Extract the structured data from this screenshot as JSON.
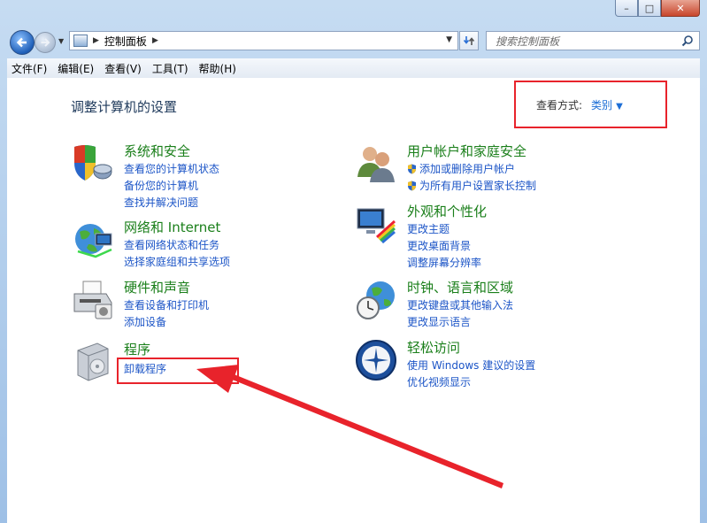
{
  "window": {
    "controls": {
      "minimize": "–",
      "maximize": "□",
      "close": "✕"
    }
  },
  "address": {
    "breadcrumb": "控制面板"
  },
  "search": {
    "placeholder": "搜索控制面板"
  },
  "menu": [
    "文件(F)",
    "编辑(E)",
    "查看(V)",
    "工具(T)",
    "帮助(H)"
  ],
  "heading": "调整计算机的设置",
  "view_mode": {
    "label": "查看方式:",
    "value": "类别"
  },
  "categories": {
    "system": {
      "title": "系统和安全",
      "links": [
        "查看您的计算机状态",
        "备份您的计算机",
        "查找并解决问题"
      ],
      "icon": "shield-icon"
    },
    "network": {
      "title": "网络和 Internet",
      "links": [
        "查看网络状态和任务",
        "选择家庭组和共享选项"
      ],
      "icon": "globe-network-icon"
    },
    "hardware": {
      "title": "硬件和声音",
      "links": [
        "查看设备和打印机",
        "添加设备"
      ],
      "icon": "printer-icon"
    },
    "programs": {
      "title": "程序",
      "links": [
        "卸载程序"
      ],
      "icon": "programs-box-icon"
    },
    "users": {
      "title": "用户帐户和家庭安全",
      "links": [
        "添加或删除用户帐户",
        "为所有用户设置家长控制"
      ],
      "icon": "users-icon"
    },
    "appearance": {
      "title": "外观和个性化",
      "links": [
        "更改主题",
        "更改桌面背景",
        "调整屏幕分辨率"
      ],
      "icon": "monitor-palette-icon"
    },
    "clock": {
      "title": "时钟、语言和区域",
      "links": [
        "更改键盘或其他输入法",
        "更改显示语言"
      ],
      "icon": "clock-globe-icon"
    },
    "ease": {
      "title": "轻松访问",
      "links": [
        "使用 Windows 建议的设置",
        "优化视频显示"
      ],
      "icon": "ease-of-access-icon"
    }
  },
  "colors": {
    "highlight": "#e8232b",
    "link": "#1c55c7",
    "category_title": "#1a7f1a"
  }
}
